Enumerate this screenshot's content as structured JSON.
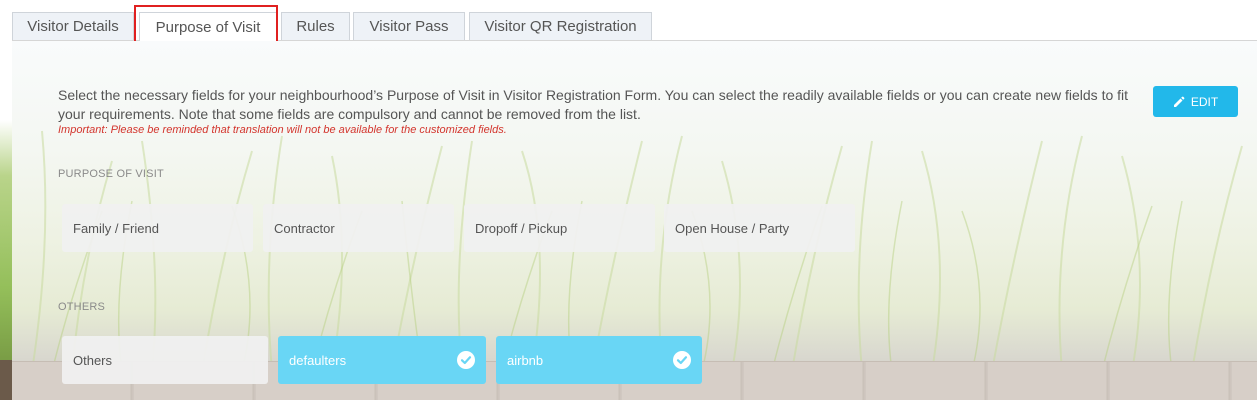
{
  "tabs": [
    {
      "label": "Visitor Details",
      "active": false
    },
    {
      "label": "Purpose of Visit",
      "active": true
    },
    {
      "label": "Rules",
      "active": false
    },
    {
      "label": "Visitor Pass",
      "active": false
    },
    {
      "label": "Visitor QR Registration",
      "active": false
    }
  ],
  "description": "Select the necessary fields for your neighbourhood’s Purpose of Visit in Visitor Registration Form. You can select the readily available fields or you can create new fields to fit your requirements. Note that some fields are compulsory and cannot be removed from the list.",
  "important_note": "Important: Please be reminded that translation will not be available for the customized fields.",
  "edit_button": {
    "label": "EDIT",
    "icon": "pencil-icon"
  },
  "purpose_section": {
    "label": "PURPOSE OF VISIT",
    "items": [
      {
        "label": "Family / Friend",
        "selected": false
      },
      {
        "label": "Contractor",
        "selected": false
      },
      {
        "label": "Dropoff / Pickup",
        "selected": false
      },
      {
        "label": "Open House / Party",
        "selected": false
      }
    ]
  },
  "others_section": {
    "label": "OTHERS",
    "items": [
      {
        "label": "Others",
        "selected": false
      },
      {
        "label": "defaulters",
        "selected": true
      },
      {
        "label": "airbnb",
        "selected": true
      }
    ]
  },
  "colors": {
    "accent": "#22b8ea",
    "selected_chip": "#69d6f5",
    "important_text": "#d3352d",
    "highlight_border": "#e02020"
  }
}
